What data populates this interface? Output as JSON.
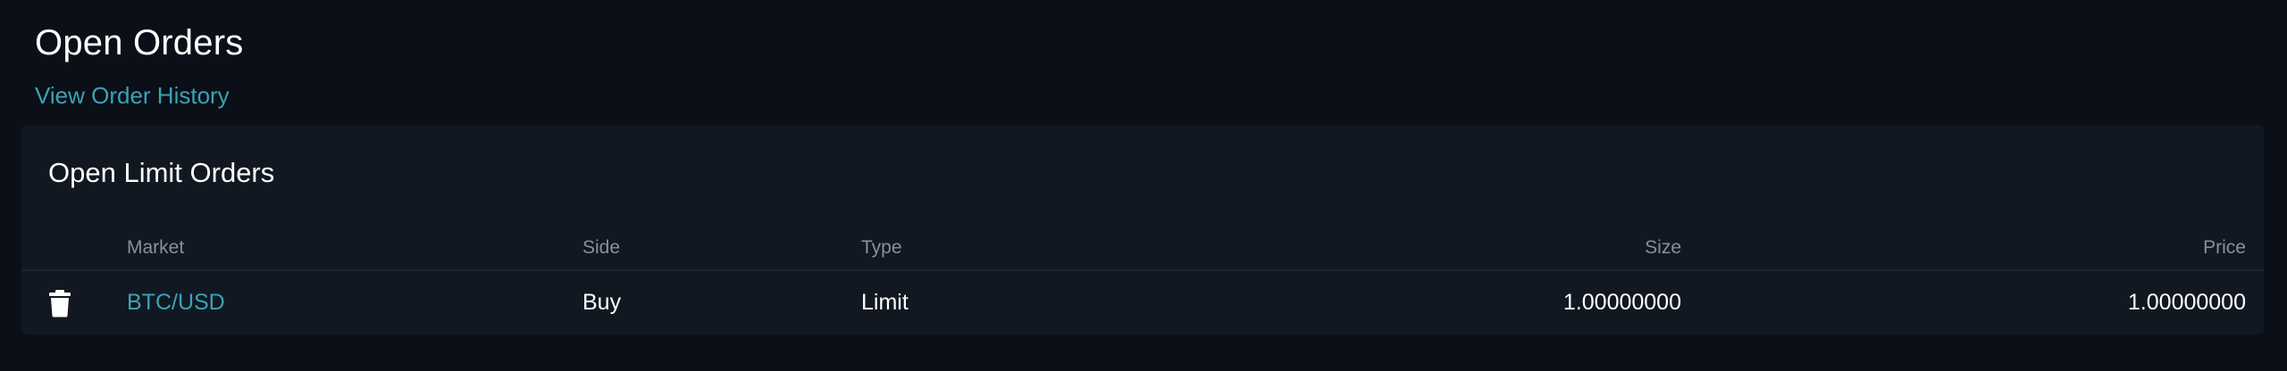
{
  "header": {
    "title": "Open Orders",
    "history_link": "View Order History"
  },
  "card": {
    "title": "Open Limit Orders",
    "columns": {
      "market": "Market",
      "side": "Side",
      "type": "Type",
      "size": "Size",
      "price": "Price"
    },
    "rows": [
      {
        "action_icon": "trash-icon",
        "market": "BTC/USD",
        "side": "Buy",
        "type": "Limit",
        "size": "1.00000000",
        "price": "1.00000000"
      }
    ]
  },
  "colors": {
    "background": "#0b0f17",
    "card": "#121821",
    "accent": "#3aa3b5",
    "muted": "#8a9099"
  }
}
